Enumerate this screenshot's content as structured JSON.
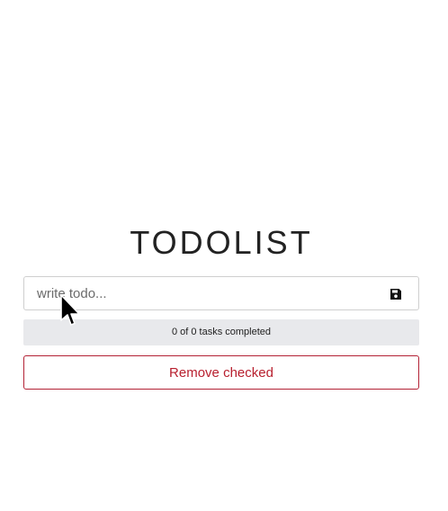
{
  "app": {
    "title": "TODOLIST"
  },
  "todo_input": {
    "placeholder": "write todo...",
    "value": "",
    "save_icon": "floppy-disk-icon"
  },
  "progress": {
    "completed": 0,
    "total": 0,
    "text": "0 of 0 tasks completed"
  },
  "actions": {
    "remove_checked_label": "Remove checked"
  },
  "colors": {
    "danger": "#b8202f",
    "progress_bg": "#e8e9ec",
    "input_border": "#cfcfcf",
    "text": "#222222"
  },
  "pointer": {
    "icon": "mouse-pointer-icon"
  }
}
